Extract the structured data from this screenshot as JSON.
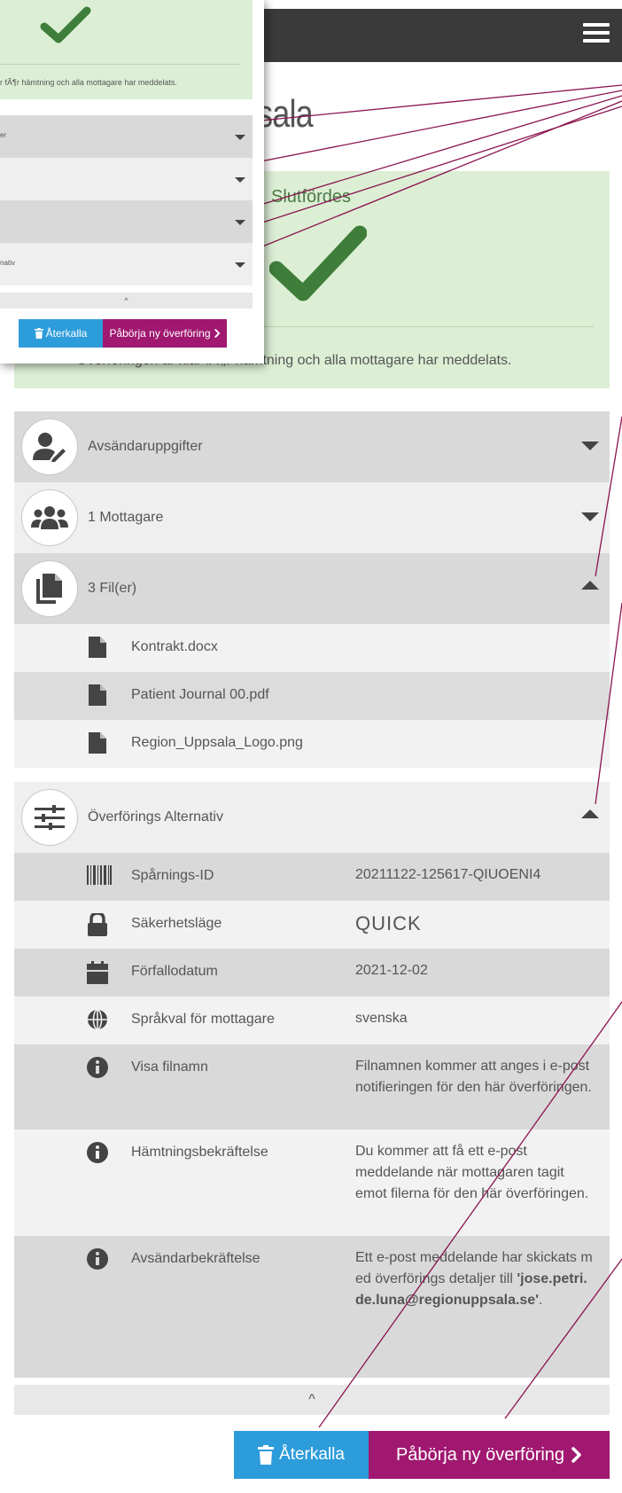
{
  "page": {
    "title_fragment": "sala"
  },
  "success": {
    "title": "Slutfördes",
    "message": "Överföringen är klar fÃ¶r hämtning och alla mottagare har meddelats.",
    "accent_color": "#3f7d3a",
    "background_color": "#dcefd5"
  },
  "accordion": {
    "sender": {
      "label": "Avsändaruppgifter",
      "icon": "user-edit-icon"
    },
    "recipients": {
      "label": "1 Mottagare",
      "icon": "users-icon"
    },
    "files": {
      "label": "3 Fil(er)",
      "icon": "files-icon",
      "items": [
        "Kontrakt.docx",
        "Patient Journal 00.pdf",
        "Region_Uppsala_Logo.png"
      ]
    },
    "options": {
      "label": "Överförings Alternativ",
      "icon": "sliders-icon",
      "rows": [
        {
          "key": "Spårnings-ID",
          "value": "20211122-125617-QIUOENI4",
          "icon": "barcode-icon"
        },
        {
          "key": "Säkerhetsläge",
          "value": "QUICK",
          "icon": "lock-icon"
        },
        {
          "key": "Förfallodatum",
          "value": "2021-12-02",
          "icon": "calendar-icon"
        },
        {
          "key": "Språkval för mottagare",
          "value": "svenska",
          "icon": "globe-icon"
        },
        {
          "key": "Visa filnamn",
          "value": "Filnamnen kommer att anges i e-post notifieringen för den här överföringen.",
          "icon": "info-icon"
        },
        {
          "key": "Hämtningsbekräftelse",
          "value": "Du kommer att få ett e-post meddelande när mottagaren tagit emot filerna för den här överföringen.",
          "icon": "info-icon"
        },
        {
          "key": "Avsändarbekräftelse",
          "value_prefix": "Ett e-post meddelande har skickats med överförings detaljer till",
          "value_email": "'jose.petri.de.luna@regionuppsala.se'",
          "value_suffix": ".",
          "icon": "info-icon"
        }
      ]
    },
    "collapse_glyph": "^"
  },
  "buttons": {
    "recall": {
      "label": "Återkalla",
      "color": "#2d9cdb",
      "icon": "trash-icon"
    },
    "new_transfer": {
      "label": "Påbörja ny överföring",
      "color": "#a01870",
      "icon": "chevron-right-icon"
    }
  },
  "inset": {
    "message": "r fÃ¶r hämtning och alla mottagare har meddelats.",
    "row1": "er",
    "row4": "nativ",
    "collapse_glyph": "^",
    "recall_label": "Återkalla",
    "new_label": "Påbörja ny överföring"
  },
  "colors": {
    "header_dark": "#3a3a3a",
    "row_dark": "#d9d9d9",
    "row_light": "#f2f2f2",
    "leader_line": "#8a1450"
  }
}
